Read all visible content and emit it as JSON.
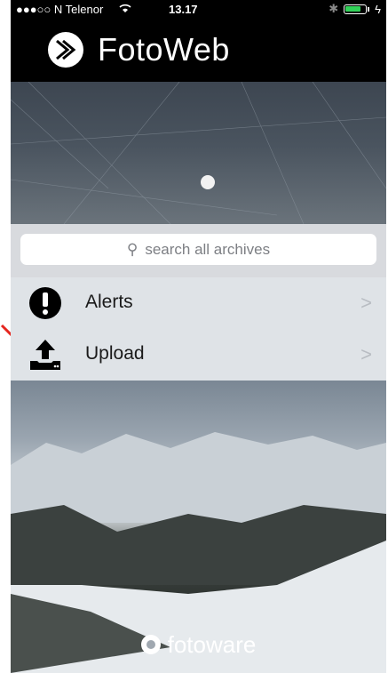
{
  "statusbar": {
    "carrier": "●●●○○ N Telenor",
    "time": "13.17",
    "bluetooth": "✱"
  },
  "header": {
    "title": "FotoWeb"
  },
  "search": {
    "placeholder": "search all archives"
  },
  "menu": {
    "items": [
      {
        "label": "Alerts",
        "icon": "exclamation-circle-icon"
      },
      {
        "label": "Upload",
        "icon": "upload-icon"
      }
    ]
  },
  "footer": {
    "brand": "fotoware"
  },
  "colors": {
    "header_bg": "#000000",
    "menu_bg": "#dfe3e7",
    "arrow": "#e5261f",
    "battery": "#31d158"
  }
}
